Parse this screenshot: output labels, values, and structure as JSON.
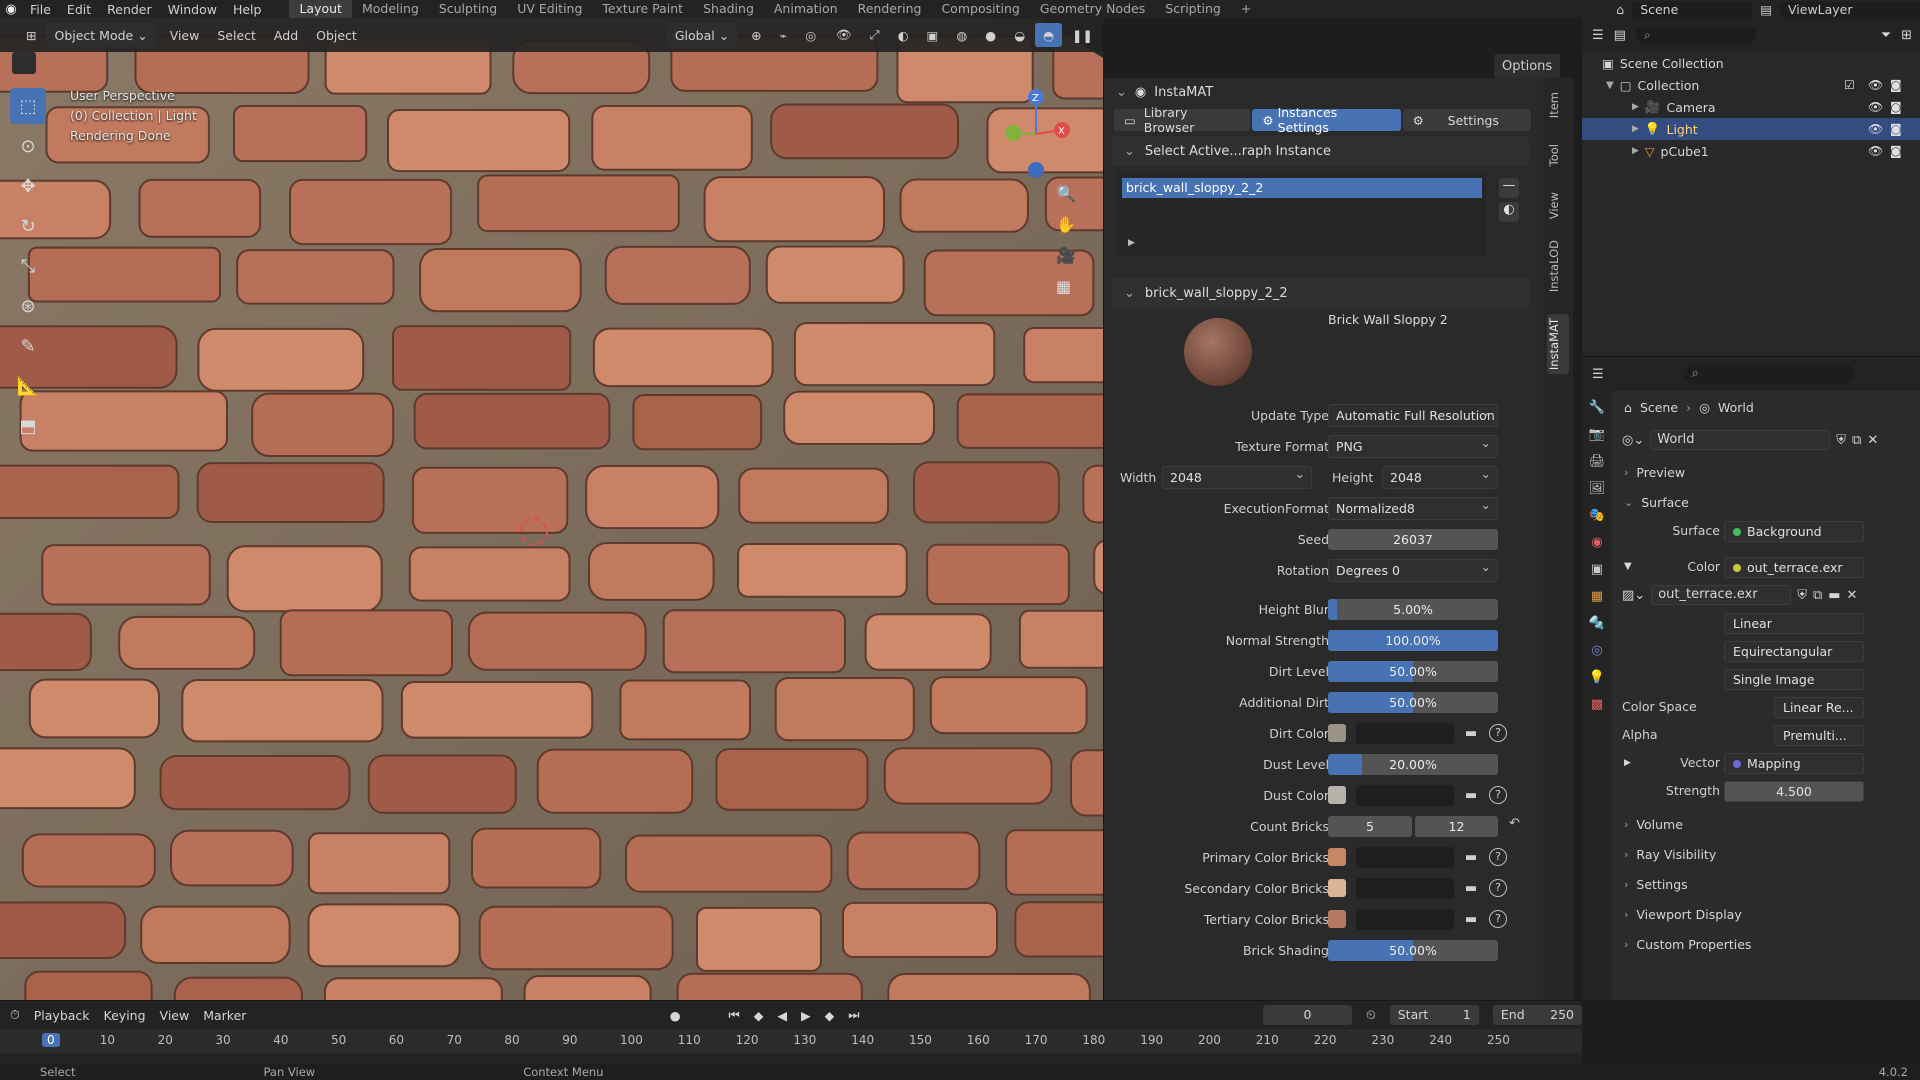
{
  "topbar": {
    "menus": [
      "File",
      "Edit",
      "Render",
      "Window",
      "Help"
    ],
    "workspaces": [
      "Layout",
      "Modeling",
      "Sculpting",
      "UV Editing",
      "Texture Paint",
      "Shading",
      "Animation",
      "Rendering",
      "Compositing",
      "Geometry Nodes",
      "Scripting"
    ],
    "active_workspace": "Layout",
    "plus": "+",
    "scene": "Scene",
    "viewlayer": "ViewLayer"
  },
  "viewport_header": {
    "mode": "Object Mode",
    "menus": [
      "View",
      "Select",
      "Add",
      "Object"
    ],
    "transform": "Global",
    "options": "Options"
  },
  "viewport_overlay": {
    "line1": "User Perspective",
    "line2": "(0) Collection | Light",
    "line3": "Rendering Done"
  },
  "gizmo": {
    "z": "Z",
    "x": "X",
    "y": "Y"
  },
  "instamat": {
    "title": "InstaMAT",
    "tabs": {
      "library": "Library Browser",
      "instances": "Instances Settings",
      "settings": "Settings"
    },
    "select_section": "Select Active...raph Instance",
    "list_item": "brick_wall_sloppy_2_2",
    "instance_section": "brick_wall_sloppy_2_2",
    "material_name": "Brick Wall Sloppy 2",
    "props": {
      "update_type": {
        "label": "Update Type",
        "value": "Automatic Full Resolution"
      },
      "texture_format": {
        "label": "Texture Format",
        "value": "PNG"
      },
      "width": {
        "label": "Width",
        "value": "2048"
      },
      "height": {
        "label": "Height",
        "value": "2048"
      },
      "execution_format": {
        "label": "ExecutionFormat",
        "value": "Normalized8"
      },
      "seed": {
        "label": "Seed",
        "value": "26037"
      },
      "rotation": {
        "label": "Rotation",
        "value": "Degrees 0"
      },
      "height_blur": {
        "label": "Height Blur",
        "value": "5.00%",
        "fraction": 0.05
      },
      "normal_strength": {
        "label": "Normal Strength",
        "value": "100.00%",
        "fraction": 1.0
      },
      "dirt_level": {
        "label": "Dirt Level",
        "value": "50.00%",
        "fraction": 0.5
      },
      "additional_dirt": {
        "label": "Additional Dirt",
        "value": "50.00%",
        "fraction": 0.5
      },
      "dirt_color": {
        "label": "Dirt Color",
        "color": "#9a9484"
      },
      "dust_level": {
        "label": "Dust Level",
        "value": "20.00%",
        "fraction": 0.2
      },
      "dust_color": {
        "label": "Dust Color",
        "color": "#b8b3aa"
      },
      "count_bricks": {
        "label": "Count Bricks",
        "a": "5",
        "b": "12"
      },
      "primary_color": {
        "label": "Primary Color Bricks",
        "color": "#c88764"
      },
      "secondary_color": {
        "label": "Secondary Color Bricks",
        "color": "#d9b497"
      },
      "tertiary_color": {
        "label": "Tertiary Color Bricks",
        "color": "#b47760"
      },
      "brick_shading": {
        "label": "Brick Shading",
        "value": "50.00%",
        "fraction": 0.5
      }
    },
    "help": "?"
  },
  "ntabs": [
    "Item",
    "Tool",
    "View",
    "InstaLOD",
    "InstaMAT"
  ],
  "outliner": {
    "root": "Scene Collection",
    "collection": "Collection",
    "items": [
      "Camera",
      "Light",
      "pCube1"
    ],
    "selected": "Light"
  },
  "properties": {
    "breadcrumb_scene": "Scene",
    "breadcrumb_world": "World",
    "world_name": "World",
    "sections": {
      "preview": "Preview",
      "surface": "Surface",
      "volume": "Volume",
      "ray": "Ray Visibility",
      "settings": "Settings",
      "viewport": "Viewport Display",
      "custom": "Custom Properties"
    },
    "surface": {
      "label": "Surface",
      "value": "Background"
    },
    "color": {
      "label": "Color",
      "value": "out_terrace.exr"
    },
    "image_name": "out_terrace.exr",
    "interp": "Linear",
    "projection": "Equirectangular",
    "source": "Single Image",
    "color_space": {
      "label": "Color Space",
      "value": "Linear Re..."
    },
    "alpha": {
      "label": "Alpha",
      "value": "Premulti..."
    },
    "vector": {
      "label": "Vector",
      "value": "Mapping"
    },
    "strength": {
      "label": "Strength",
      "value": "4.500"
    }
  },
  "timeline": {
    "menus": [
      "Playback",
      "Keying",
      "View",
      "Marker"
    ],
    "current_frame": "0",
    "start_label": "Start",
    "start": "1",
    "end_label": "End",
    "end": "250",
    "ticks": [
      "0",
      "10",
      "20",
      "30",
      "40",
      "50",
      "60",
      "70",
      "80",
      "90",
      "100",
      "110",
      "120",
      "130",
      "140",
      "150",
      "160",
      "170",
      "180",
      "190",
      "200",
      "210",
      "220",
      "230",
      "240",
      "250"
    ]
  },
  "statusbar": {
    "select": "Select",
    "pan": "Pan View",
    "context": "Context Menu",
    "version": "4.0.2"
  },
  "colors": {
    "accent": "#4772b3",
    "panel": "#2a2a2a",
    "header": "#232323"
  }
}
